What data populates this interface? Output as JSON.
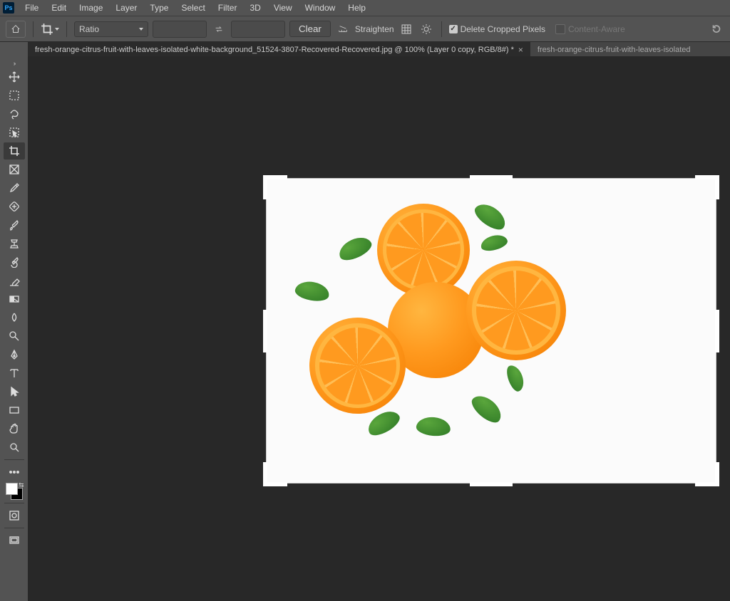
{
  "app": {
    "logo_text": "Ps"
  },
  "menu": [
    "File",
    "Edit",
    "Image",
    "Layer",
    "Type",
    "Select",
    "Filter",
    "3D",
    "View",
    "Window",
    "Help"
  ],
  "options": {
    "ratio_label": "Ratio",
    "width_value": "",
    "height_value": "",
    "clear_label": "Clear",
    "straighten_label": "Straighten",
    "delete_cropped_label": "Delete Cropped Pixels",
    "delete_cropped_checked": true,
    "content_aware_label": "Content-Aware",
    "content_aware_checked": false
  },
  "tabs": {
    "active": "fresh-orange-citrus-fruit-with-leaves-isolated-white-background_51524-3807-Recovered-Recovered.jpg @ 100% (Layer 0 copy, RGB/8#) *",
    "inactive": "fresh-orange-citrus-fruit-with-leaves-isolated"
  },
  "tools": [
    {
      "name": "move-tool"
    },
    {
      "name": "marquee-tool"
    },
    {
      "name": "lasso-tool"
    },
    {
      "name": "object-select-tool"
    },
    {
      "name": "crop-tool",
      "active": true
    },
    {
      "name": "frame-tool"
    },
    {
      "name": "eyedropper-tool"
    },
    {
      "name": "healing-brush-tool"
    },
    {
      "name": "brush-tool"
    },
    {
      "name": "clone-stamp-tool"
    },
    {
      "name": "history-brush-tool"
    },
    {
      "name": "eraser-tool"
    },
    {
      "name": "gradient-tool"
    },
    {
      "name": "blur-tool"
    },
    {
      "name": "dodge-tool"
    },
    {
      "name": "pen-tool"
    },
    {
      "name": "type-tool"
    },
    {
      "name": "path-select-tool"
    },
    {
      "name": "rectangle-tool"
    },
    {
      "name": "hand-tool"
    },
    {
      "name": "zoom-tool"
    }
  ],
  "extratools": [
    {
      "name": "edit-toolbar"
    },
    {
      "name": "quick-mask"
    },
    {
      "name": "screen-mode"
    }
  ]
}
